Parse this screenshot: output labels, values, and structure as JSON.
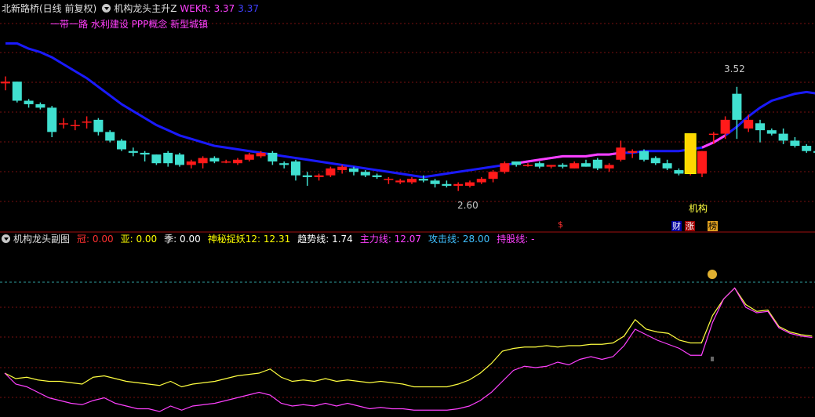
{
  "main_header": {
    "title": "北新路桥(日线 前复权)",
    "indicator": "机构龙头主升Z",
    "wekr_label": "WEKR: 3.37",
    "wekr_value": "3.37",
    "concepts": "一带一路 水利建设 PPP概念 新型城镇"
  },
  "sub_header": {
    "title": "机构龙头副图",
    "items": [
      {
        "label": "冠: 0.00",
        "color": "#ff3030"
      },
      {
        "label": "亚: 0.00",
        "color": "#ffff00"
      },
      {
        "label": "季: 0.00",
        "color": "#ffffff"
      },
      {
        "label": "神秘捉妖12: 12.31",
        "color": "#ffff00"
      },
      {
        "label": "趋势线: 1.74",
        "color": "#ffffff"
      },
      {
        "label": "主力线: 12.07",
        "color": "#ff40ff"
      },
      {
        "label": "攻击线: 28.00",
        "color": "#40c0ff"
      },
      {
        "label": "持股线: -",
        "color": "#ff40ff"
      }
    ]
  },
  "annotations": {
    "high": "3.52",
    "low": "2.60",
    "jigou": "机构",
    "cai": "财",
    "zhang": "涨",
    "bang": "榜",
    "dollar": "$"
  },
  "colors": {
    "up": "#ff1a1a",
    "down": "#40e0d0",
    "trend": "#1a1aff",
    "signal": "#ff40ff",
    "yellow": "#ffff40",
    "grid": "#7a1010"
  },
  "chart_data": [
    {
      "type": "candlestick",
      "title": "北新路桥(日线 前复权)",
      "ylim": [
        2.5,
        3.62
      ],
      "candles": [
        [
          3.23,
          3.27,
          3.19,
          3.24
        ],
        [
          3.24,
          3.24,
          3.12,
          3.13
        ],
        [
          3.13,
          3.14,
          3.09,
          3.11
        ],
        [
          3.11,
          3.12,
          3.08,
          3.09
        ],
        [
          3.09,
          3.1,
          2.92,
          2.95
        ],
        [
          3.0,
          3.03,
          2.97,
          3.0
        ],
        [
          2.99,
          3.02,
          2.96,
          2.99
        ],
        [
          3.01,
          3.04,
          2.97,
          3.01
        ],
        [
          3.02,
          3.03,
          2.93,
          2.95
        ],
        [
          2.95,
          2.96,
          2.89,
          2.9
        ],
        [
          2.9,
          2.91,
          2.84,
          2.85
        ],
        [
          2.84,
          2.86,
          2.81,
          2.83
        ],
        [
          2.83,
          2.84,
          2.78,
          2.82
        ],
        [
          2.82,
          2.82,
          2.76,
          2.77
        ],
        [
          2.83,
          2.84,
          2.75,
          2.77
        ],
        [
          2.82,
          2.83,
          2.75,
          2.76
        ],
        [
          2.76,
          2.79,
          2.74,
          2.78
        ],
        [
          2.77,
          2.81,
          2.74,
          2.8
        ],
        [
          2.8,
          2.81,
          2.77,
          2.78
        ],
        [
          2.78,
          2.79,
          2.77,
          2.78
        ],
        [
          2.77,
          2.8,
          2.76,
          2.79
        ],
        [
          2.79,
          2.83,
          2.78,
          2.82
        ],
        [
          2.81,
          2.84,
          2.8,
          2.83
        ],
        [
          2.83,
          2.84,
          2.76,
          2.78
        ],
        [
          2.77,
          2.78,
          2.74,
          2.76
        ],
        [
          2.78,
          2.79,
          2.67,
          2.7
        ],
        [
          2.7,
          2.72,
          2.64,
          2.69
        ],
        [
          2.69,
          2.71,
          2.67,
          2.7
        ],
        [
          2.7,
          2.75,
          2.69,
          2.74
        ],
        [
          2.73,
          2.76,
          2.71,
          2.75
        ],
        [
          2.74,
          2.75,
          2.7,
          2.72
        ],
        [
          2.72,
          2.73,
          2.69,
          2.7
        ],
        [
          2.7,
          2.71,
          2.68,
          2.69
        ],
        [
          2.68,
          2.69,
          2.65,
          2.68
        ],
        [
          2.66,
          2.68,
          2.65,
          2.67
        ],
        [
          2.66,
          2.69,
          2.65,
          2.68
        ],
        [
          2.68,
          2.7,
          2.66,
          2.67
        ],
        [
          2.67,
          2.68,
          2.63,
          2.65
        ],
        [
          2.65,
          2.67,
          2.63,
          2.64
        ],
        [
          2.64,
          2.66,
          2.61,
          2.65
        ],
        [
          2.64,
          2.67,
          2.63,
          2.66
        ],
        [
          2.66,
          2.69,
          2.65,
          2.68
        ],
        [
          2.68,
          2.73,
          2.66,
          2.72
        ],
        [
          2.72,
          2.78,
          2.71,
          2.77
        ],
        [
          2.78,
          2.78,
          2.75,
          2.76
        ],
        [
          2.76,
          2.77,
          2.75,
          2.76
        ],
        [
          2.77,
          2.78,
          2.74,
          2.75
        ],
        [
          2.75,
          2.76,
          2.74,
          2.76
        ],
        [
          2.76,
          2.77,
          2.74,
          2.75
        ],
        [
          2.74,
          2.78,
          2.74,
          2.77
        ],
        [
          2.77,
          2.79,
          2.75,
          2.75
        ],
        [
          2.79,
          2.8,
          2.73,
          2.74
        ],
        [
          2.74,
          2.77,
          2.72,
          2.76
        ],
        [
          2.79,
          2.9,
          2.78,
          2.86
        ],
        [
          2.83,
          2.85,
          2.8,
          2.84
        ],
        [
          2.84,
          2.85,
          2.78,
          2.79
        ],
        [
          2.8,
          2.81,
          2.76,
          2.77
        ],
        [
          2.77,
          2.79,
          2.73,
          2.74
        ],
        [
          2.73,
          2.74,
          2.7,
          2.71
        ],
        [
          2.72,
          2.73,
          2.7,
          2.72
        ],
        [
          2.71,
          2.84,
          2.69,
          2.84
        ],
        [
          2.94,
          2.95,
          2.88,
          2.94
        ],
        [
          2.94,
          3.04,
          2.91,
          3.02
        ],
        [
          3.17,
          3.21,
          2.91,
          3.02
        ],
        [
          2.97,
          3.05,
          2.95,
          3.02
        ],
        [
          3.0,
          3.02,
          2.89,
          2.96
        ],
        [
          2.96,
          2.97,
          2.93,
          2.94
        ],
        [
          2.94,
          2.97,
          2.88,
          2.9
        ],
        [
          2.9,
          2.92,
          2.86,
          2.87
        ],
        [
          2.87,
          2.88,
          2.83,
          2.84
        ],
        [
          2.84,
          2.85,
          2.81,
          2.83
        ],
        [
          2.83,
          2.85,
          2.8,
          2.83
        ]
      ],
      "trend_line": [
        3.46,
        3.46,
        3.43,
        3.41,
        3.38,
        3.34,
        3.3,
        3.26,
        3.21,
        3.16,
        3.11,
        3.07,
        3.03,
        2.99,
        2.96,
        2.93,
        2.91,
        2.89,
        2.87,
        2.86,
        2.85,
        2.84,
        2.83,
        2.82,
        2.81,
        2.8,
        2.79,
        2.78,
        2.77,
        2.76,
        2.75,
        2.74,
        2.73,
        2.72,
        2.71,
        2.7,
        2.69,
        2.7,
        2.71,
        2.72,
        2.73,
        2.74,
        2.75,
        2.76,
        2.77,
        2.78,
        2.79,
        2.8,
        2.81,
        2.81,
        2.81,
        2.82,
        2.82,
        2.83,
        2.83,
        2.84,
        2.84,
        2.84,
        2.84,
        2.85,
        2.86,
        2.89,
        2.93,
        2.98,
        3.04,
        3.09,
        3.13,
        3.15,
        3.17,
        3.18,
        3.17,
        3.13
      ],
      "markers": {
        "high": "3.52",
        "low": "2.60"
      }
    },
    {
      "type": "line",
      "title": "机构龙头副图",
      "ylim": [
        0,
        100
      ],
      "series": [
        {
          "name": "神秘捉妖12",
          "values": [
            28,
            24,
            25,
            23,
            22,
            22,
            21,
            20,
            25,
            26,
            24,
            22,
            21,
            20,
            19,
            22,
            18,
            20,
            21,
            22,
            24,
            26,
            27,
            28,
            31,
            25,
            22,
            23,
            22,
            24,
            22,
            23,
            22,
            21,
            22,
            21,
            20,
            18,
            18,
            18,
            18,
            20,
            23,
            28,
            35,
            44,
            46,
            47,
            47,
            48,
            47,
            48,
            48,
            49,
            49,
            50,
            55,
            67,
            60,
            58,
            57,
            52,
            50,
            50,
            70,
            82,
            90,
            78,
            73,
            74,
            62,
            58,
            56,
            55
          ]
        },
        {
          "name": "主力线",
          "values": [
            28,
            20,
            18,
            14,
            10,
            8,
            6,
            5,
            8,
            10,
            6,
            4,
            2,
            2,
            0,
            4,
            1,
            4,
            5,
            6,
            8,
            10,
            12,
            14,
            12,
            6,
            4,
            5,
            4,
            6,
            4,
            6,
            4,
            2,
            3,
            2,
            2,
            1,
            1,
            1,
            1,
            2,
            4,
            8,
            14,
            22,
            30,
            33,
            32,
            33,
            36,
            34,
            38,
            40,
            38,
            40,
            48,
            60,
            56,
            52,
            49,
            46,
            41,
            41,
            65,
            82,
            90,
            76,
            72,
            73,
            61,
            57,
            55,
            54
          ]
        }
      ],
      "levels": [
        0.0,
        0.0,
        0.0,
        12.31,
        1.74,
        12.07,
        28.0
      ]
    }
  ]
}
